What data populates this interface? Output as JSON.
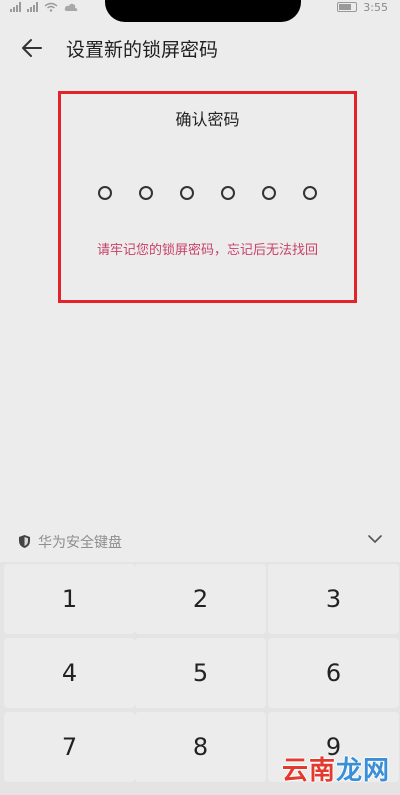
{
  "status_bar": {
    "time": "3:55"
  },
  "header": {
    "title": "设置新的锁屏密码"
  },
  "confirm": {
    "title": "确认密码",
    "dot_count": 6,
    "warning": "请牢记您的锁屏密码，忘记后无法找回",
    "highlight_color": "#e2242a",
    "warning_color": "#c8416a"
  },
  "keyboard": {
    "label": "华为安全键盘",
    "keys": [
      "1",
      "2",
      "3",
      "4",
      "5",
      "6",
      "7",
      "8",
      "9"
    ]
  },
  "watermark": {
    "part1": "云南",
    "part2": "龙网"
  }
}
